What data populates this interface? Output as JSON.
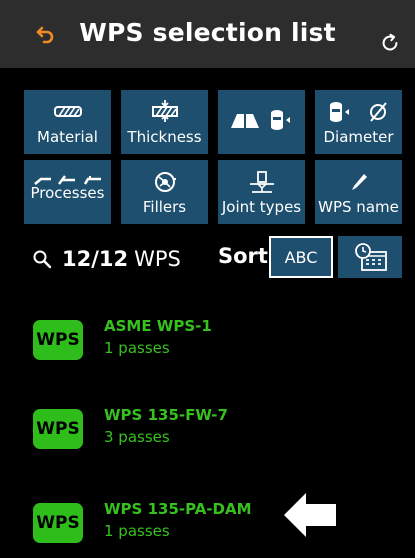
{
  "header": {
    "title": "WPS selection list",
    "back_icon": "undo-arrow-icon",
    "refresh_icon": "refresh-icon"
  },
  "filters": [
    {
      "label": "Material",
      "icon": "material-icon"
    },
    {
      "label": "Thickness",
      "icon": "thickness-icon"
    },
    {
      "label": "",
      "icon": "joint-shape-icon"
    },
    {
      "label": "Diameter",
      "icon": "diameter-icon"
    },
    {
      "label": "Processes",
      "icon": "processes-icon"
    },
    {
      "label": "Fillers",
      "icon": "filler-spool-icon"
    },
    {
      "label": "Joint types",
      "icon": "joint-types-icon"
    },
    {
      "label": "WPS name",
      "icon": "pencil-icon"
    }
  ],
  "summary": {
    "count": "12/12",
    "unit": "WPS",
    "sort_label": "Sort",
    "abc_label": "ABC"
  },
  "items": [
    {
      "badge": "WPS",
      "name": "ASME WPS-1",
      "passes": "1 passes"
    },
    {
      "badge": "WPS",
      "name": "WPS 135-FW-7",
      "passes": "3 passes"
    },
    {
      "badge": "WPS",
      "name": "WPS 135-PA-DAM",
      "passes": "1 passes"
    }
  ],
  "colors": {
    "accent_green": "#37c11f",
    "button_blue": "#1f4f6e",
    "header_bg": "#2d2d2d",
    "back_orange": "#f08a24"
  }
}
